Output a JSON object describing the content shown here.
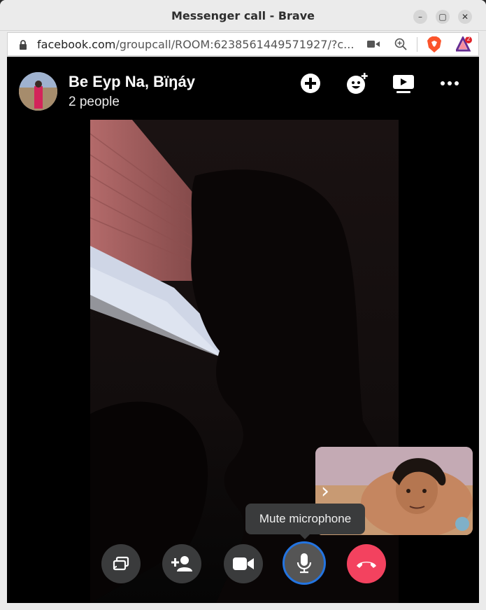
{
  "window": {
    "title": "Messenger call - Brave",
    "controls": [
      "minimize",
      "maximize",
      "close"
    ]
  },
  "address_bar": {
    "host": "facebook.com",
    "path": "/groupcall/ROOM:6238561449571927/?c...",
    "extension_badge": "2"
  },
  "call": {
    "group_name": "Be Eyp Na, Bïŋáy",
    "participants": "2 people",
    "header_actions": [
      "add-icon",
      "effects-icon",
      "watch-together-icon",
      "more-icon"
    ],
    "tooltip": "Mute microphone",
    "controls": [
      "share-screen",
      "add-person",
      "camera",
      "microphone",
      "end-call"
    ]
  },
  "colors": {
    "end_call": "#f3425f",
    "active_ring": "#2374e1",
    "control_bg": "#3a3b3c"
  }
}
